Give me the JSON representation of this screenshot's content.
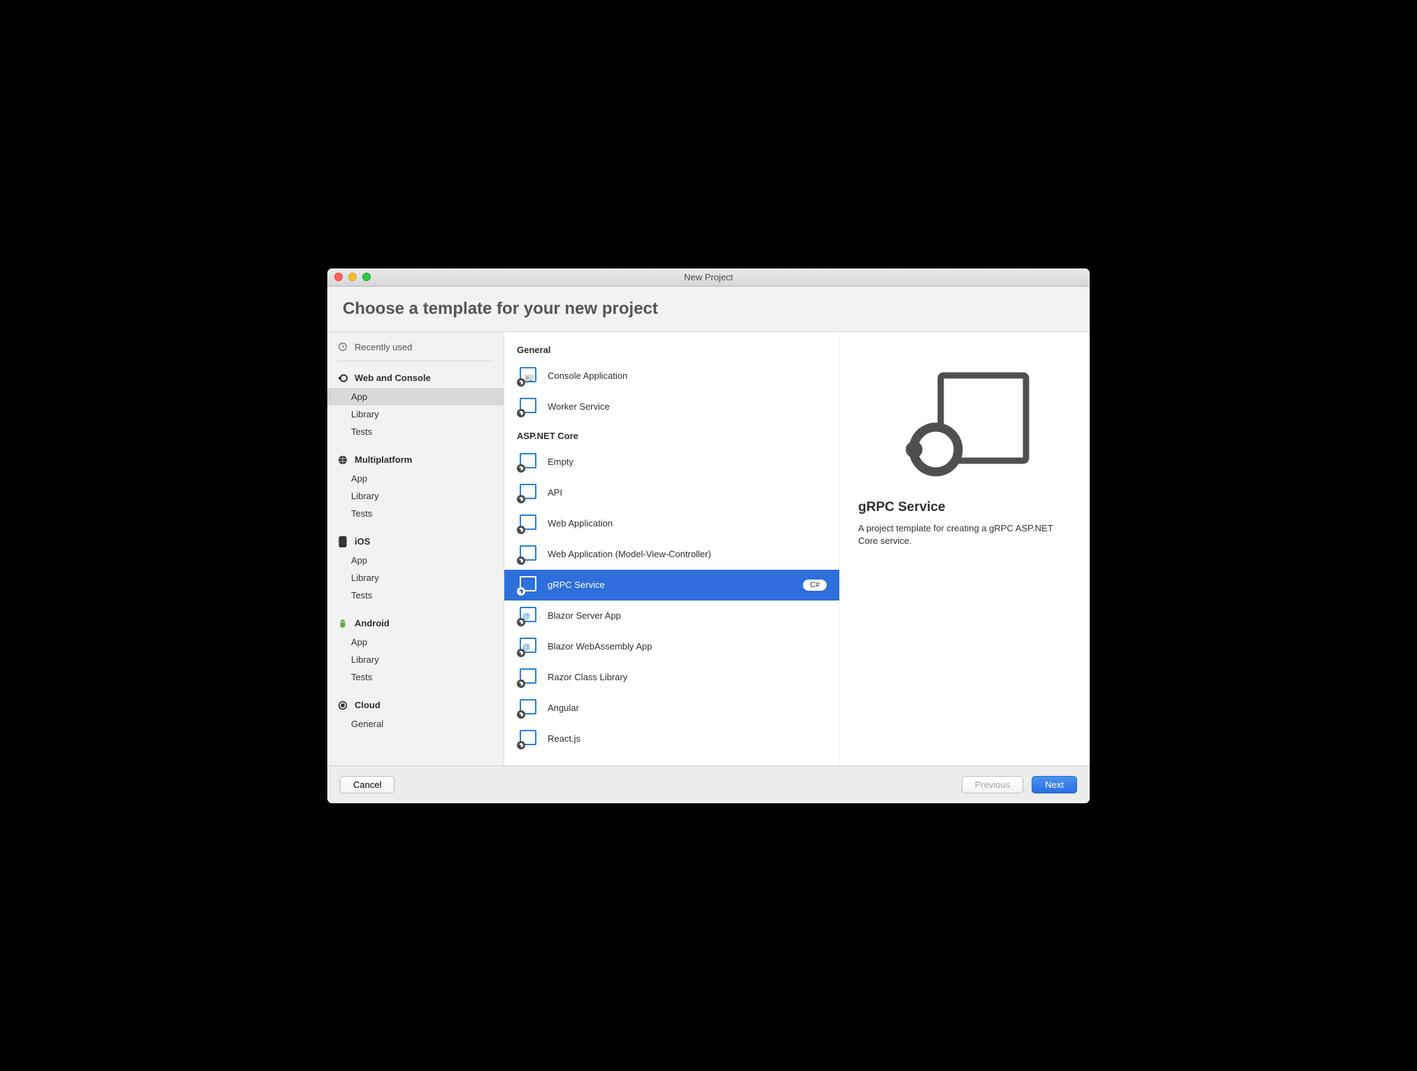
{
  "window": {
    "title": "New Project"
  },
  "header": {
    "title": "Choose a template for your new project"
  },
  "sidebar": {
    "recent": "Recently used",
    "categories": [
      {
        "name": "Web and Console",
        "icon": "dotnet",
        "items": [
          "App",
          "Library",
          "Tests"
        ],
        "selectedIndex": 0
      },
      {
        "name": "Multiplatform",
        "icon": "multiplatform",
        "items": [
          "App",
          "Library",
          "Tests"
        ]
      },
      {
        "name": "iOS",
        "icon": "ios",
        "items": [
          "App",
          "Library",
          "Tests"
        ]
      },
      {
        "name": "Android",
        "icon": "android",
        "items": [
          "App",
          "Library",
          "Tests"
        ]
      },
      {
        "name": "Cloud",
        "icon": "cloud",
        "items": [
          "General"
        ]
      }
    ]
  },
  "templates": {
    "sections": [
      {
        "title": "General",
        "items": [
          {
            "label": "Console Application",
            "icon": "console"
          },
          {
            "label": "Worker Service",
            "icon": "plain"
          }
        ]
      },
      {
        "title": "ASP.NET Core",
        "items": [
          {
            "label": "Empty",
            "icon": "plain"
          },
          {
            "label": "API",
            "icon": "plain"
          },
          {
            "label": "Web Application",
            "icon": "plain"
          },
          {
            "label": "Web Application (Model-View-Controller)",
            "icon": "plain"
          },
          {
            "label": "gRPC Service",
            "icon": "plain",
            "selected": true,
            "badge": "C#"
          },
          {
            "label": "Blazor Server App",
            "icon": "blazor"
          },
          {
            "label": "Blazor WebAssembly App",
            "icon": "blazor"
          },
          {
            "label": "Razor Class Library",
            "icon": "plain"
          },
          {
            "label": "Angular",
            "icon": "plain"
          },
          {
            "label": "React.js",
            "icon": "plain"
          }
        ]
      }
    ]
  },
  "details": {
    "title": "gRPC Service",
    "description": "A project template for creating a gRPC ASP.NET Core service."
  },
  "footer": {
    "cancel": "Cancel",
    "previous": "Previous",
    "next": "Next"
  }
}
